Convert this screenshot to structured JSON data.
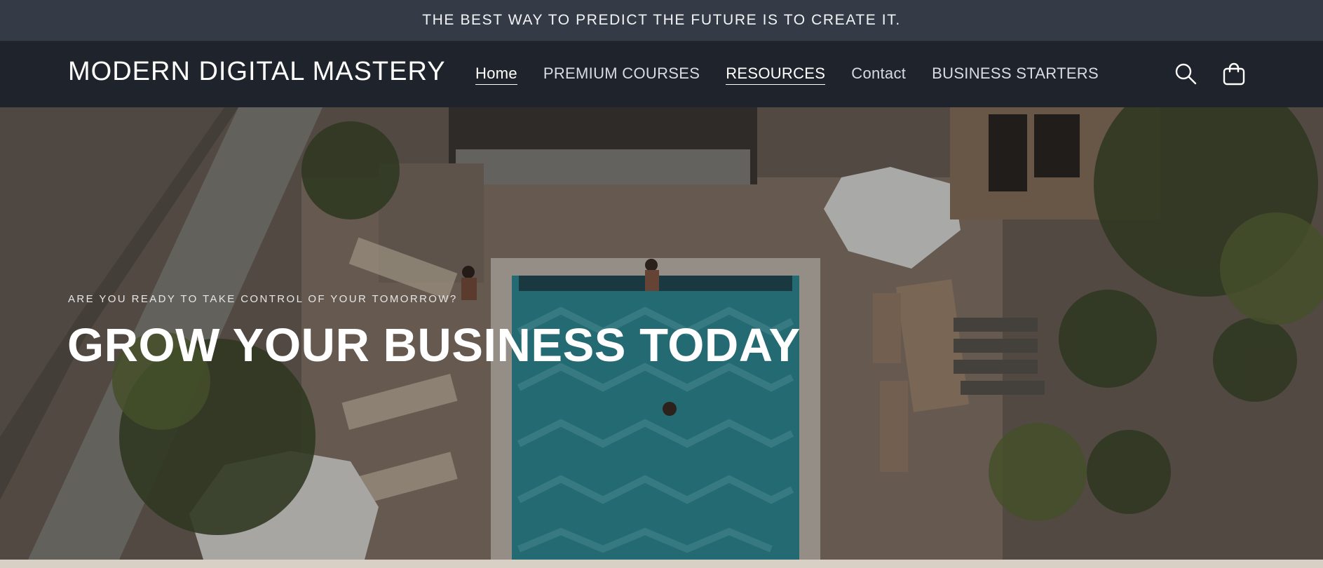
{
  "announcement": {
    "text": "THE BEST WAY TO PREDICT THE FUTURE IS TO CREATE IT."
  },
  "header": {
    "logo": "MODERN DIGITAL MASTERY",
    "nav": [
      {
        "label": "Home",
        "active": true
      },
      {
        "label": "PREMIUM COURSES",
        "active": false
      },
      {
        "label": "RESOURCES",
        "active": true
      },
      {
        "label": "Contact",
        "active": false
      },
      {
        "label": "BUSINESS STARTERS",
        "active": false
      }
    ],
    "icons": {
      "search": "search-icon",
      "cart": "cart-icon"
    }
  },
  "hero": {
    "subheading": "ARE YOU READY TO TAKE CONTROL OF YOUR TOMORROW?",
    "heading": "GROW YOUR BUSINESS TODAY",
    "image_subject": "aerial view of a resort swimming pool with palm trees, loungers and umbrellas"
  },
  "colors": {
    "announcement_bg": "#353b46",
    "header_bg": "#1f242c",
    "text": "#ffffff",
    "pool": "#2f8f9a"
  }
}
